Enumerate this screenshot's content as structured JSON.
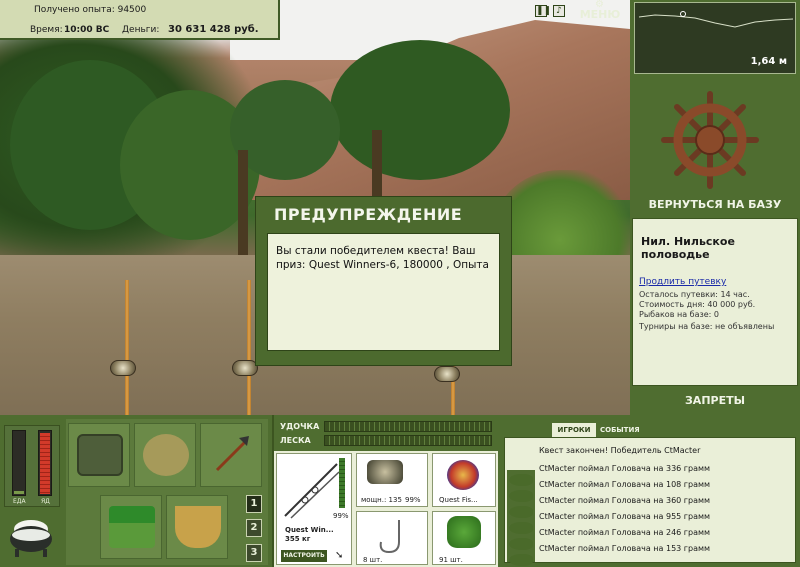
{
  "status": {
    "experience_label": "Получено опыта: 94500",
    "time_label": "Время:",
    "time_value": "10:00 ВС",
    "money_label": "Деньги:",
    "money_value": "30 631 428 руб."
  },
  "toolbar": {
    "pause_icon": "pause-icon",
    "sound_icon": "sound-icon",
    "menu_label": "МЕНЮ"
  },
  "depth": {
    "value": "1,64 м"
  },
  "location": {
    "return_label": "ВЕРНУТЬСЯ НА БАЗУ",
    "title": "Нил. Нильское половодье",
    "extend_link": "Продлить путевку",
    "remaining": "Осталось путевки: 14 час.",
    "day_cost": "Стоимость дня: 40 000 руб.",
    "anglers": "Рыбаков на базе: 0",
    "tournaments": "Турниры на базе: не объявлены",
    "bans_label": "ЗАПРЕТЫ"
  },
  "dialog": {
    "title": "ПРЕДУПРЕЖДЕНИЕ",
    "message": "Вы стали победителем квеста! Ваш приз: Quest Winners-6, 180000 , Опыта"
  },
  "meters": {
    "food_label": "ЕДА",
    "poison_label": "ЯД",
    "food_level": 0.05,
    "poison_level": 0.95
  },
  "inventory": {
    "pages": [
      "1",
      "2",
      "3"
    ],
    "active_page": "1"
  },
  "gear": {
    "rod_label": "УДОЧКА",
    "line_label": "ЛЕСКА",
    "rod_name": "Quest Win...",
    "rod_weight": "355 кг",
    "rod_percent": "99%",
    "reel_label": "мощн.: 135",
    "reel_percent": "99%",
    "bait_label": "Quest Fis...",
    "hook_count": "8 шт.",
    "lure_count": "91 шт.",
    "tune_label": "НАСТРОИТЬ"
  },
  "chat": {
    "tab_players": "ИГРОКИ",
    "tab_events": "СОБЫТИЯ",
    "header": "Квест закончен! Победитель CtMacter",
    "lines": [
      "CtMacter поймал Головача на 336 грамм",
      "CtMacter поймал Головача на 108 грамм",
      "CtMacter поймал Головача на 360 грамм",
      "CtMacter поймал Головача на 955 грамм",
      "CtMacter поймал Головача на 246 грамм",
      "CtMacter поймал Головача на 153 грамм"
    ]
  },
  "colors": {
    "panel_green": "#4f6d30",
    "panel_light": "#eaefd8",
    "link_blue": "#1a2aa8",
    "poison_red": "#d23a2a"
  }
}
